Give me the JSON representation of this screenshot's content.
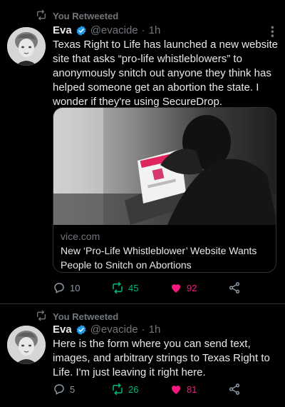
{
  "tweets": [
    {
      "retweet_label": "You Retweeted",
      "author_name": "Eva",
      "handle": "@evacide",
      "separator": "·",
      "time": "1h",
      "text": "Texas Right to Life has launched a new website site that asks “pro-life whistleblowers” to anonymously snitch out anyone they think has helped someone get an abortion the state. I wonder if they're using SecureDrop.",
      "card": {
        "domain": "vice.com",
        "title": "New ‘Pro-Life Whistleblower’ Website Wants People to Snitch on Abortions"
      },
      "replies": "10",
      "retweets": "45",
      "likes": "92"
    },
    {
      "retweet_label": "You Retweeted",
      "author_name": "Eva",
      "handle": "@evacide",
      "separator": "·",
      "time": "1h",
      "text": "Here is the form where you can send text, images, and arbitrary strings to Texas Right to Life. I'm just leaving it right here.",
      "replies": "5",
      "retweets": "26",
      "likes": "81"
    }
  ],
  "colors": {
    "background": "#000000",
    "text": "#e7e9ea",
    "muted": "#71767b",
    "retweet_active": "#00ba7c",
    "like_active": "#f91880",
    "verified": "#1d9bf0"
  },
  "icons": [
    "retweet-icon",
    "verified-badge-icon",
    "more-icon",
    "reply-icon",
    "like-icon",
    "share-icon"
  ]
}
